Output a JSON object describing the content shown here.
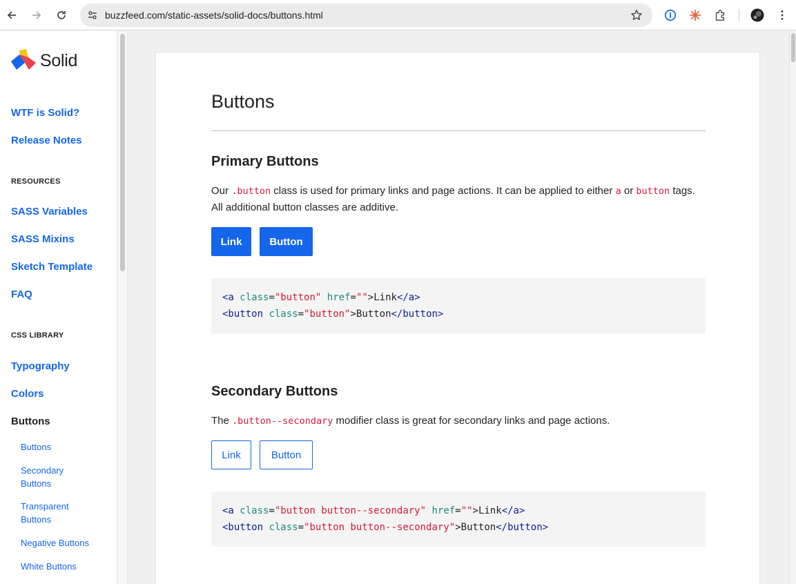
{
  "browser": {
    "url": "buzzfeed.com/static-assets/solid-docs/buttons.html"
  },
  "sidebar": {
    "logo_text": "Solid",
    "links_top": [
      "WTF is Solid?",
      "Release Notes"
    ],
    "resources_heading": "RESOURCES",
    "resources_links": [
      "SASS Variables",
      "SASS Mixins",
      "Sketch Template",
      "FAQ"
    ],
    "css_heading": "CSS LIBRARY",
    "css_links": [
      "Typography",
      "Colors"
    ],
    "active_item": "Buttons",
    "sub_items": [
      "Buttons",
      "Secondary Buttons",
      "Transparent Buttons",
      "Negative Buttons",
      "White Buttons"
    ]
  },
  "page": {
    "title": "Buttons",
    "primary": {
      "heading": "Primary Buttons",
      "text_1": "Our",
      "code_1": ".button",
      "text_2": "class is used for primary links and page actions. It can be applied to either",
      "code_2": "a",
      "text_3": "or",
      "code_3": "button",
      "text_4": "tags. All additional button classes are additive.",
      "btn_link": "Link",
      "btn_button": "Button",
      "code_lines": [
        {
          "open": "<a",
          "attr1": "class",
          "val1": "\"button\"",
          "attr2": "href",
          "val2": "\"\"",
          "close": ">",
          "inner": "Link",
          "end": "</a>"
        },
        {
          "open": "<button",
          "attr1": "class",
          "val1": "\"button\"",
          "close": ">",
          "inner": "Button",
          "end": "</button>"
        }
      ]
    },
    "secondary": {
      "heading": "Secondary Buttons",
      "text_1": "The",
      "code_1": ".button--secondary",
      "text_2": "modifier class is great for secondary links and page actions.",
      "btn_link": "Link",
      "btn_button": "Button",
      "code_lines": [
        {
          "open": "<a",
          "attr1": "class",
          "val1": "\"button button--secondary\"",
          "attr2": "href",
          "val2": "\"\"",
          "close": ">",
          "inner": "Link",
          "end": "</a>"
        },
        {
          "open": "<button",
          "attr1": "class",
          "val1": "\"button button--secondary\"",
          "close": ">",
          "inner": "Button",
          "end": "</button>"
        }
      ]
    }
  },
  "colors": {
    "link_blue": "#1466ea",
    "code_red": "#d7193a",
    "code_tag": "#0a1f8f",
    "code_attr": "#1a8b80"
  }
}
